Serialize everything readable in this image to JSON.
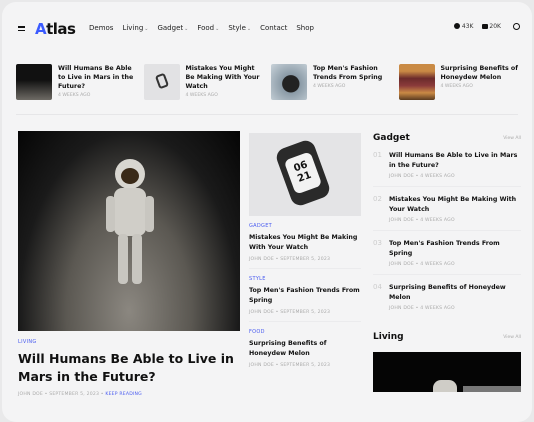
{
  "header": {
    "logo": "Atlas",
    "nav": [
      {
        "label": "Demos",
        "dropdown": false
      },
      {
        "label": "Living",
        "dropdown": true
      },
      {
        "label": "Gadget",
        "dropdown": true
      },
      {
        "label": "Food",
        "dropdown": true
      },
      {
        "label": "Style",
        "dropdown": true
      },
      {
        "label": "Contact",
        "dropdown": false
      },
      {
        "label": "Shop",
        "dropdown": false
      }
    ],
    "facebook_count": "43K",
    "youtube_count": "20K"
  },
  "strip": [
    {
      "title": "Will Humans Be Able to Live in Mars in the Future?",
      "meta": "4 WEEKS AGO"
    },
    {
      "title": "Mistakes You Might Be Making With Your Watch",
      "meta": "4 WEEKS AGO"
    },
    {
      "title": "Top Men's Fashion Trends From Spring",
      "meta": "4 WEEKS AGO"
    },
    {
      "title": "Surprising Benefits of Honeydew Melon",
      "meta": "4 WEEKS AGO"
    }
  ],
  "hero": {
    "category": "LIVING",
    "title": "Will Humans Be Able to Live in Mars in the Future?",
    "author": "JOHN DOE",
    "date": "SEPTEMBER 5, 2023",
    "keep_reading": "KEEP READING"
  },
  "middle": [
    {
      "category": "GADGET",
      "title": "Mistakes You Might Be Making With Your Watch",
      "meta": "JOHN DOE • SEPTEMBER 5, 2023"
    },
    {
      "category": "STYLE",
      "title": "Top Men's Fashion Trends From Spring",
      "meta": "JOHN DOE • SEPTEMBER 5, 2023"
    },
    {
      "category": "FOOD",
      "title": "Surprising Benefits of Honeydew Melon",
      "meta": "JOHN DOE • SEPTEMBER 5, 2023"
    }
  ],
  "watch_display": [
    "06",
    "21"
  ],
  "gadget": {
    "heading": "Gadget",
    "view_all": "View All",
    "items": [
      {
        "num": "01",
        "title": "Will Humans Be Able to Live in Mars in the Future?",
        "meta": "JOHN DOE • 4 WEEKS AGO"
      },
      {
        "num": "02",
        "title": "Mistakes You Might Be Making With Your Watch",
        "meta": "JOHN DOE • 4 WEEKS AGO"
      },
      {
        "num": "03",
        "title": "Top Men's Fashion Trends From Spring",
        "meta": "JOHN DOE • 4 WEEKS AGO"
      },
      {
        "num": "04",
        "title": "Surprising Benefits of Honeydew Melon",
        "meta": "JOHN DOE • 4 WEEKS AGO"
      }
    ]
  },
  "living": {
    "heading": "Living",
    "view_all": "View All"
  }
}
